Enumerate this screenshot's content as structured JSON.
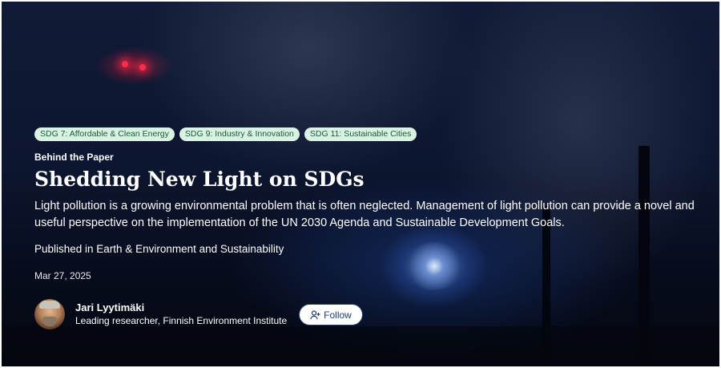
{
  "tags": [
    "SDG 7: Affordable & Clean Energy",
    "SDG 9: Industry & Innovation",
    "SDG 11: Sustainable Cities"
  ],
  "kicker": "Behind the Paper",
  "title": "Shedding New Light on SDGs",
  "description": "Light pollution is a growing environmental problem that is often neglected. Management of light pollution can provide a novel and useful perspective on the implementation of the UN 2030 Agenda and Sustainable Development Goals.",
  "published": "Published in Earth & Environment and Sustainability",
  "date": "Mar 27, 2025",
  "author": {
    "name": "Jari Lyytimäki",
    "role": "Leading researcher, Finnish Environment Institute"
  },
  "follow": {
    "label": "Follow",
    "icon": "add-user-icon"
  }
}
